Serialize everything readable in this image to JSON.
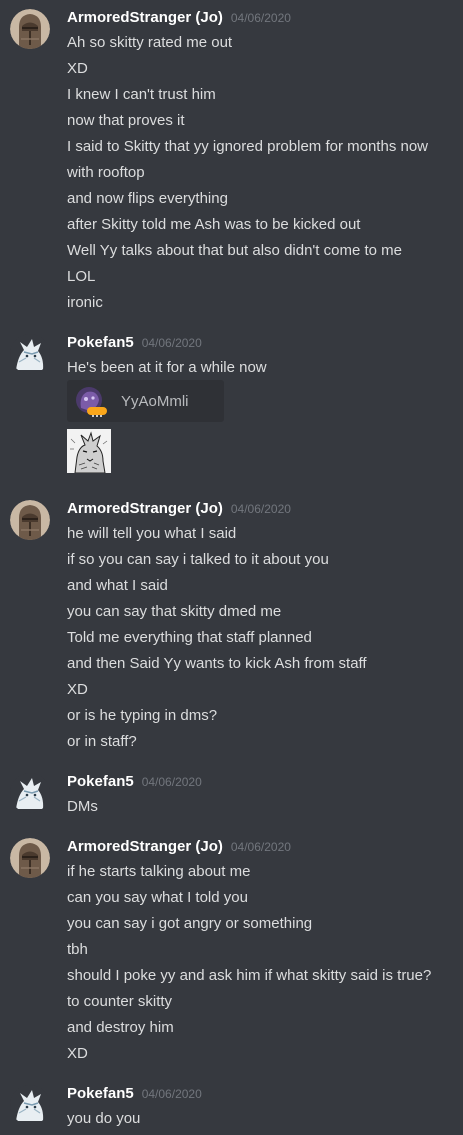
{
  "colors": {
    "background": "#36393f",
    "username": "#ffffff",
    "timestamp": "#72767d",
    "text": "#dcddde",
    "embed_background": "#2f3136",
    "badge": "#faa61a"
  },
  "messages": [
    {
      "author": "ArmoredStranger (Jo)",
      "avatar_icon": "armored-knight-avatar-icon",
      "timestamp": "04/06/2020",
      "lines": [
        "Ah so skitty rated me out",
        "XD",
        "I knew I can't trust him",
        "now that proves it",
        "I said to Skitty that yy ignored problem for months now with rooftop",
        "and now flips everything",
        "after Skitty told me Ash was to be kicked out",
        "Well Yy talks about that but also didn't come to me",
        "LOL",
        "ironic"
      ]
    },
    {
      "author": "Pokefan5",
      "avatar_icon": "white-wolf-avatar-icon",
      "timestamp": "04/06/2020",
      "lines": [
        "He's been at it for a while now"
      ],
      "mention_card": {
        "name": "YyAoMmli",
        "avatar_icon": "purple-creature-avatar-icon",
        "badge_icon": "orange-status-badge-icon"
      },
      "sticker_icon": "wolf-sketch-sticker-icon"
    },
    {
      "author": "ArmoredStranger (Jo)",
      "avatar_icon": "armored-knight-avatar-icon",
      "timestamp": "04/06/2020",
      "lines": [
        "he will tell you what I said",
        "if so you can say i talked to it about you",
        "and what I said",
        "you can say that skitty dmed me",
        "Told me everything that staff planned",
        "and then Said Yy wants to kick Ash from staff",
        "XD",
        "or is he typing in dms?",
        "or in staff?"
      ]
    },
    {
      "author": "Pokefan5",
      "avatar_icon": "white-wolf-avatar-icon",
      "timestamp": "04/06/2020",
      "lines": [
        "DMs"
      ]
    },
    {
      "author": "ArmoredStranger (Jo)",
      "avatar_icon": "armored-knight-avatar-icon",
      "timestamp": "04/06/2020",
      "lines": [
        "if he starts talking about me",
        "can you say what I told you",
        "you can say i got angry or something",
        "tbh",
        "should I poke yy and ask him if what skitty said is true?",
        "to counter skitty",
        "and destroy him",
        "XD"
      ]
    },
    {
      "author": "Pokefan5",
      "avatar_icon": "white-wolf-avatar-icon",
      "timestamp": "04/06/2020",
      "lines": [
        "you do you"
      ]
    }
  ]
}
